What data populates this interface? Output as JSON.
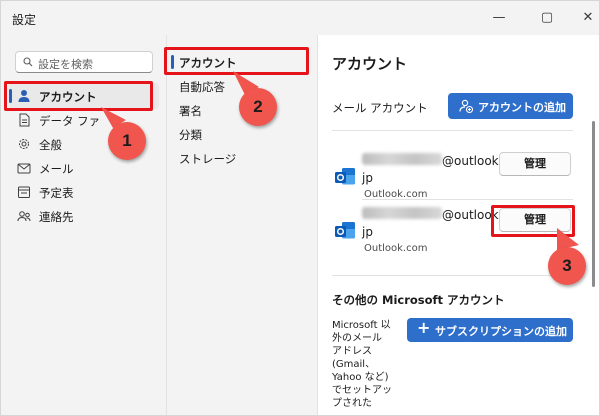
{
  "window": {
    "title": "設定",
    "controls": {
      "minimize": "—",
      "maximize": "▢",
      "close": "✕"
    }
  },
  "left_nav": {
    "search_placeholder": "設定を検索",
    "items": [
      {
        "label": "アカウント",
        "icon": "person-icon",
        "selected": true
      },
      {
        "label": "データ ファ",
        "icon": "document-icon",
        "selected": false
      },
      {
        "label": "全般",
        "icon": "gear-icon",
        "selected": false
      },
      {
        "label": "メール",
        "icon": "mail-icon",
        "selected": false
      },
      {
        "label": "予定表",
        "icon": "calendar-icon",
        "selected": false
      },
      {
        "label": "連絡先",
        "icon": "people-icon",
        "selected": false
      }
    ]
  },
  "middle_nav": {
    "items": [
      {
        "label": "アカウント",
        "selected": true
      },
      {
        "label": "自動応答",
        "selected": false
      },
      {
        "label": "署名",
        "selected": false
      },
      {
        "label": "分類",
        "selected": false
      },
      {
        "label": "ストレージ",
        "selected": false
      }
    ]
  },
  "account_pane": {
    "title": "アカウント",
    "mail_section_title": "メール アカウント",
    "add_account_label": "アカウントの追加",
    "accounts": [
      {
        "email_domain": "@outlook.",
        "email_tld": "jp",
        "provider": "Outlook.com",
        "manage_label": "管理"
      },
      {
        "email_domain": "@outlook.",
        "email_tld": "jp",
        "provider": "Outlook.com",
        "manage_label": "管理"
      }
    ],
    "other_section_title": "その他の Microsoft アカウント",
    "other_description": "Microsoft 以外のメール アドレス (Gmail、Yahoo など) でセットアップされた",
    "add_subscription_label": "サブスクリプションの追加"
  },
  "annotations": {
    "callouts": [
      "1",
      "2",
      "3"
    ],
    "color": "#e5141a"
  },
  "colors": {
    "accent": "#2e6fcb",
    "selection_bar": "#2a5fb5",
    "annotation": "#e5141a",
    "callout_fill": "#f0554e"
  }
}
